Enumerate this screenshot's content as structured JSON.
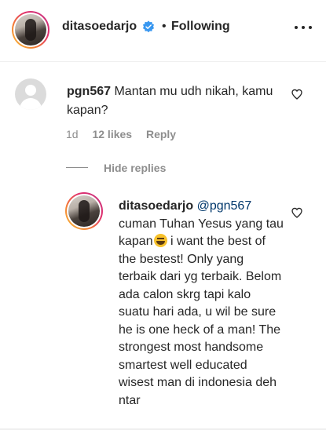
{
  "header": {
    "username": "ditasoedarjo",
    "separator": "•",
    "follow_status": "Following"
  },
  "comment": {
    "username": "pgn567",
    "text": "Mantan mu udh nikah, kamu kapan?",
    "age": "1d",
    "likes": "12 likes",
    "reply_label": "Reply"
  },
  "replies_toggle": {
    "label": "Hide replies"
  },
  "reply": {
    "username": "ditasoedarjo",
    "mention": "@pgn567",
    "text_before_emoji": "cuman Tuhan Yesus yang tau kapan",
    "emoji": "rolling-on-the-floor-laughing",
    "text_after_emoji": " i want the best of the bestest! Only yang terbaik dari yg terbaik. Belom ada calon skrg tapi kalo suatu hari ada, u wil be sure he is one heck of a man! The strongest most handsome smartest well educated wisest man di indonesia deh ntar"
  },
  "colors": {
    "text": "#262626",
    "secondary": "#8e8e8e",
    "mention": "#00376b",
    "verified": "#3897f0"
  },
  "icons": {
    "verified": "verified-badge-icon",
    "more": "more-options-icon",
    "like": "heart-icon"
  }
}
